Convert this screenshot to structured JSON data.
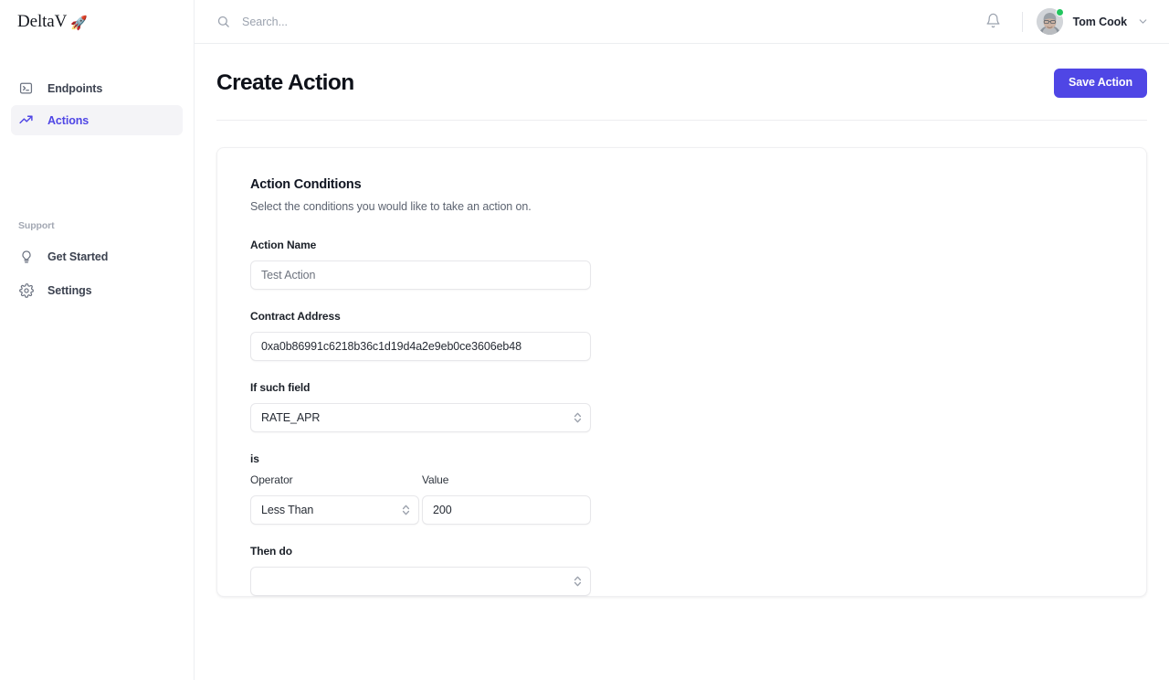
{
  "brand": {
    "name": "DeltaV",
    "emoji": "🚀"
  },
  "sidebar": {
    "primary_items": [
      {
        "label": "Endpoints",
        "icon": "terminal-icon",
        "active": false
      },
      {
        "label": "Actions",
        "icon": "trending-up-icon",
        "active": true
      }
    ],
    "support_label": "Support",
    "secondary_items": [
      {
        "label": "Get Started",
        "icon": "lightbulb-icon"
      },
      {
        "label": "Settings",
        "icon": "gear-icon"
      }
    ]
  },
  "topbar": {
    "search_placeholder": "Search...",
    "search_value": "",
    "notifications_icon": "bell-icon",
    "user": {
      "name": "Tom Cook",
      "status": "online",
      "status_color": "#22c55e"
    }
  },
  "page": {
    "title": "Create Action",
    "save_label": "Save Action"
  },
  "card": {
    "title": "Action Conditions",
    "subtitle": "Select the conditions you would like to take an action on.",
    "fields": {
      "action_name": {
        "label": "Action Name",
        "value": "Test Action",
        "placeholder": "Test Action"
      },
      "contract_address": {
        "label": "Contract Address",
        "value": "0xa0b86991c6218b36c1d19d4a2e9eb0ce3606eb48",
        "placeholder": "0xa0b86991c6218b36c1d19d4a2e9eb0ce3606eb48"
      },
      "if_such_field": {
        "label": "If such field",
        "value": "RATE_APR"
      },
      "is_label": "is",
      "operator": {
        "label": "Operator",
        "value": "Less Than"
      },
      "value": {
        "label": "Value",
        "value": "200"
      },
      "then_do": {
        "label": "Then do",
        "value": ""
      }
    }
  },
  "colors": {
    "accent": "#4f46e5",
    "status_online": "#22c55e",
    "border": "#e7e7ea"
  }
}
